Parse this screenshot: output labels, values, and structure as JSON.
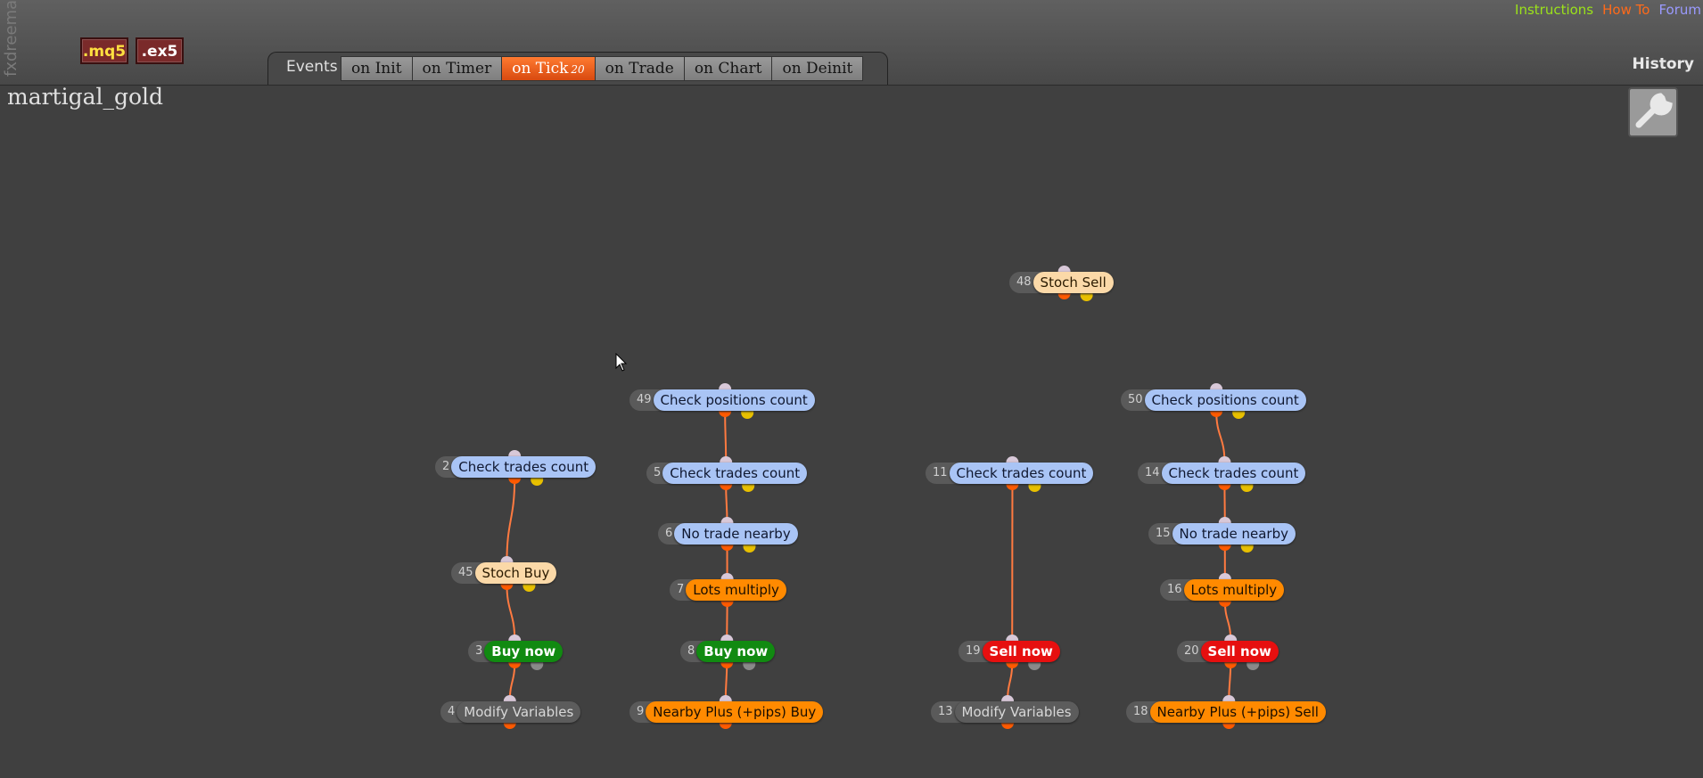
{
  "brand": "fxdreema",
  "files": {
    "mq5": ".mq5",
    "ex5": ".ex5"
  },
  "links": {
    "instructions": "Instructions",
    "howto": "How To",
    "forum": "Forum"
  },
  "history": "History",
  "events": {
    "label": "Events",
    "tabs": [
      {
        "label": "on Init"
      },
      {
        "label": "on Timer"
      },
      {
        "label": "on Tick",
        "count": "20",
        "active": true
      },
      {
        "label": "on Trade"
      },
      {
        "label": "on Chart"
      },
      {
        "label": "on Deinit"
      }
    ]
  },
  "project_name": "martigal_gold",
  "colors": {
    "accent": "#ff6a1a",
    "block_blue": "#a9c4f5",
    "block_orange": "#ff8a00",
    "block_green": "#118a11",
    "block_red": "#e60f0f",
    "block_peach": "#fbd9a8",
    "block_gray": "#5c5c5c"
  },
  "blocks": [
    {
      "id": "48",
      "label": "Stoch Sell",
      "type": "peach"
    },
    {
      "id": "49",
      "label": "Check positions count",
      "type": "blue"
    },
    {
      "id": "50",
      "label": "Check positions count",
      "type": "blue"
    },
    {
      "id": "2",
      "label": "Check trades count",
      "type": "blue"
    },
    {
      "id": "5",
      "label": "Check trades count",
      "type": "blue"
    },
    {
      "id": "11",
      "label": "Check trades count",
      "type": "blue"
    },
    {
      "id": "14",
      "label": "Check trades count",
      "type": "blue"
    },
    {
      "id": "6",
      "label": "No trade nearby",
      "type": "blue"
    },
    {
      "id": "15",
      "label": "No trade nearby",
      "type": "blue"
    },
    {
      "id": "45",
      "label": "Stoch Buy",
      "type": "peach"
    },
    {
      "id": "7",
      "label": "Lots multiply",
      "type": "orange"
    },
    {
      "id": "16",
      "label": "Lots multiply",
      "type": "orange"
    },
    {
      "id": "3",
      "label": "Buy now",
      "type": "green"
    },
    {
      "id": "8",
      "label": "Buy now",
      "type": "green"
    },
    {
      "id": "19",
      "label": "Sell now",
      "type": "red"
    },
    {
      "id": "20",
      "label": "Sell now",
      "type": "red"
    },
    {
      "id": "4",
      "label": "Modify Variables",
      "type": "gray"
    },
    {
      "id": "9",
      "label": "Nearby Plus (+pips) Buy",
      "type": "orange"
    },
    {
      "id": "13",
      "label": "Modify Variables",
      "type": "gray"
    },
    {
      "id": "18",
      "label": "Nearby Plus (+pips) Sell",
      "type": "orange"
    }
  ],
  "connections": [
    [
      "2",
      "45"
    ],
    [
      "45",
      "3"
    ],
    [
      "3",
      "4"
    ],
    [
      "49",
      "5"
    ],
    [
      "5",
      "6"
    ],
    [
      "6",
      "7"
    ],
    [
      "7",
      "8"
    ],
    [
      "8",
      "9"
    ],
    [
      "11",
      "19"
    ],
    [
      "19",
      "13"
    ],
    [
      "50",
      "14"
    ],
    [
      "14",
      "15"
    ],
    [
      "15",
      "16"
    ],
    [
      "16",
      "20"
    ],
    [
      "20",
      "18"
    ]
  ]
}
